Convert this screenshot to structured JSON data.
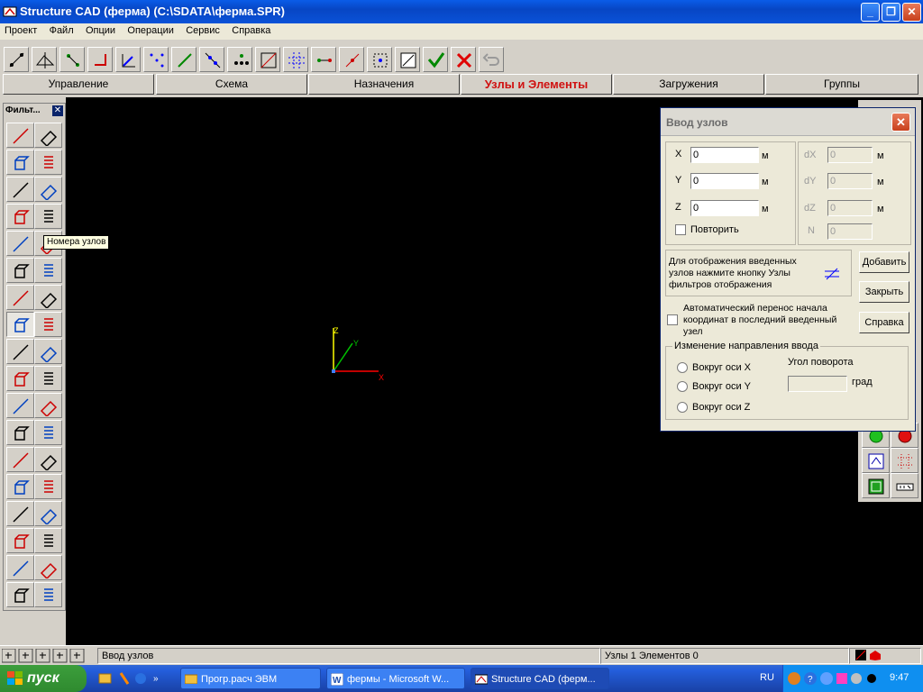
{
  "window": {
    "title": "Structure CAD (ферма) (C:\\SDATA\\ферма.SPR)"
  },
  "menu": [
    "Проект",
    "Файл",
    "Опции",
    "Операции",
    "Сервис",
    "Справка"
  ],
  "tabs": [
    "Управление",
    "Схема",
    "Назначения",
    "Узлы и Элементы",
    "Загружения",
    "Группы"
  ],
  "active_tab": "Узлы и Элементы",
  "palette": {
    "title": "Фильт...",
    "tooltip": "Номера узлов"
  },
  "axes": {
    "x": "X",
    "y": "Y",
    "z": "Z"
  },
  "dialog": {
    "title": "Ввод узлов",
    "x_label": "X",
    "y_label": "Y",
    "z_label": "Z",
    "x_value": "0",
    "y_value": "0",
    "z_value": "0",
    "unit": "м",
    "dx_label": "dX",
    "dy_label": "dY",
    "dz_label": "dZ",
    "n_label": "N",
    "dx_value": "0",
    "dy_value": "0",
    "dz_value": "0",
    "n_value": "0",
    "repeat_label": "Повторить",
    "hint": "Для отображения введенных узлов нажмите кнопку Узлы фильтров отображения",
    "auto_transfer": "Автоматический перенос начала координат в последний введенный узел",
    "direction_group": "Изменение направления ввода",
    "around_x": "Вокруг оси X",
    "around_y": "Вокруг оси Y",
    "around_z": "Вокруг оси Z",
    "rotation_angle": "Угол поворота",
    "deg": "град",
    "add_button": "Добавить",
    "close_button": "Закрыть",
    "help_button": "Справка"
  },
  "status": {
    "mode": "Ввод узлов",
    "counts": "Узлы 1 Элементов 0"
  },
  "taskbar": {
    "start": "пуск",
    "tasks": [
      "Прогр.расч ЭВМ",
      "фермы - Microsoft W...",
      "Structure CAD (ферм..."
    ],
    "lang": "RU",
    "time": "9:47"
  },
  "colors": {
    "accent_red": "#d01010",
    "canvas": "#000000",
    "axis_x": "#ff0000",
    "axis_y": "#00c000",
    "axis_z": "#ffff00"
  }
}
